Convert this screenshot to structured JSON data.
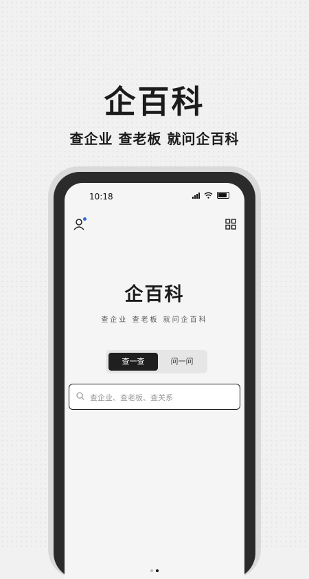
{
  "hero": {
    "title": "企百科",
    "subtitle": "查企业 查老板 就问企百科"
  },
  "status_bar": {
    "time": "10:18"
  },
  "header": {
    "user_icon": "user-icon",
    "grid_icon": "grid-icon",
    "notification_color": "#2f6bd8"
  },
  "app": {
    "logo": "企百科",
    "tagline": "查企业 查老板 就问企百科"
  },
  "tabs": [
    {
      "label": "查一查",
      "active": true
    },
    {
      "label": "问一问",
      "active": false
    }
  ],
  "search": {
    "placeholder": "查企业、查老板、查关系"
  },
  "pager": {
    "count": 2,
    "active_index": 1
  },
  "colors": {
    "accent": "#1f1f1f",
    "background": "#f1f1f1"
  }
}
